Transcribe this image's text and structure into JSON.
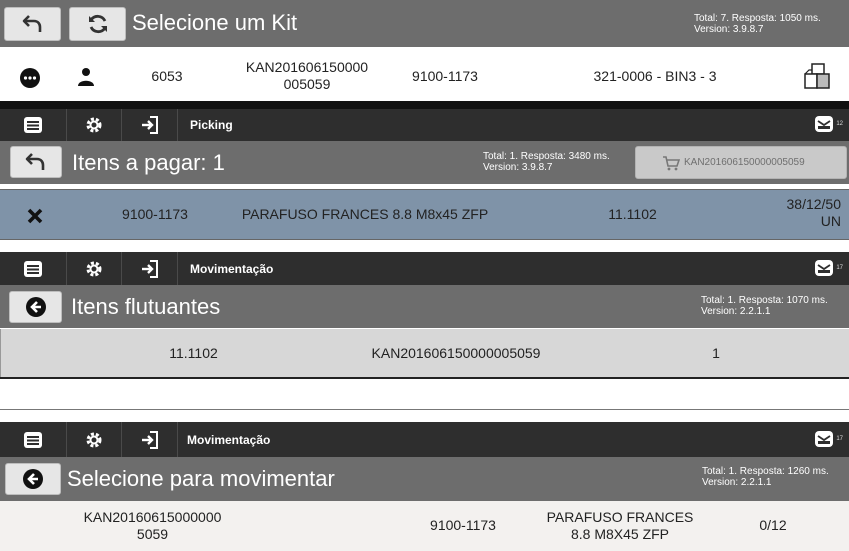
{
  "panel1": {
    "title": "Selecione um Kit",
    "meta_line1": "Total: 7. Resposta: 1050 ms.",
    "meta_line2": "Version: 3.9.8.7",
    "row": {
      "id": "6053",
      "kan_line1": "KAN201606150000",
      "kan_line2": "005059",
      "part": "9100-1173",
      "location": "321-0006 - BIN3 - 3"
    }
  },
  "panel2": {
    "nav_label": "Picking",
    "mail_count": "12",
    "title": "Itens a pagar: 1",
    "meta_line1": "Total: 1. Resposta: 3480 ms.",
    "meta_line2": "Version: 3.9.8.7",
    "cart_button": "KAN201606150000005059",
    "row": {
      "part": "9100-1173",
      "description": "PARAFUSO FRANCES 8.8  M8x45 ZFP",
      "code": "11.1102",
      "qty_line1": "38/12/50",
      "qty_line2": "UN"
    }
  },
  "panel3": {
    "nav_label": "Movimentação",
    "mail_count": "17",
    "title": "Itens flutuantes",
    "meta_line1": "Total: 1. Resposta: 1070 ms.",
    "meta_line2": "Version: 2.2.1.1",
    "row": {
      "code": "11.1102",
      "kan": "KAN201606150000005059",
      "qty": "1"
    }
  },
  "panel4": {
    "nav_label": "Movimentação",
    "mail_count": "17",
    "title": "Selecione para movimentar",
    "meta_line1": "Total: 1. Resposta: 1260 ms.",
    "meta_line2": "Version: 2.2.1.1",
    "row": {
      "kan_line1": "KAN20160615000000",
      "kan_line2": "5059",
      "part": "9100-1173",
      "desc_line1": "PARAFUSO FRANCES",
      "desc_line2": "8.8  M8X45 ZFP",
      "qty": "0/12"
    }
  },
  "colors": {
    "titlebar": "#6d6d6d",
    "navbar": "#2e2e2e",
    "selected_row": "#7f93a8",
    "row_grey": "#d7d7d7",
    "row_light": "#f3f1ef"
  }
}
